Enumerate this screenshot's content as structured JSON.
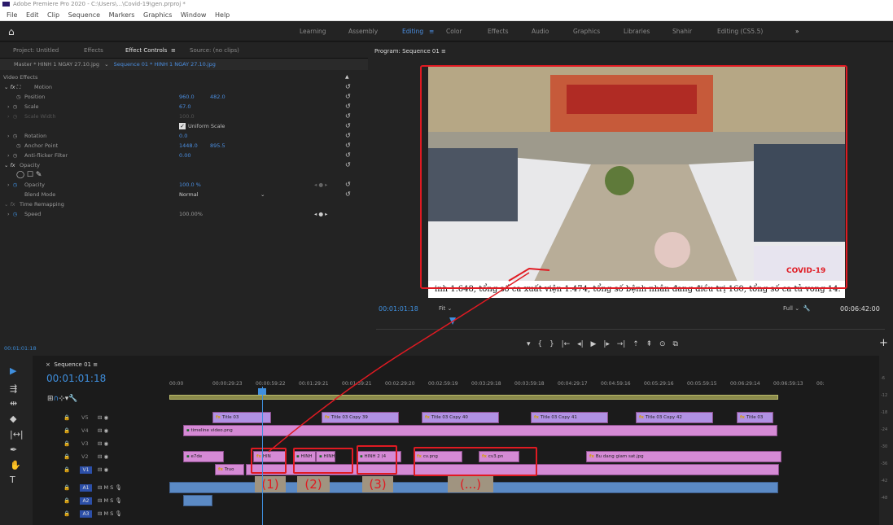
{
  "app": {
    "title": "Adobe Premiere Pro 2020 - C:\\Users\\...\\Covid-19\\gen.prproj *"
  },
  "menu": [
    "File",
    "Edit",
    "Clip",
    "Sequence",
    "Markers",
    "Graphics",
    "Window",
    "Help"
  ],
  "workspaces": [
    "Learning",
    "Assembly",
    "Editing",
    "Color",
    "Effects",
    "Audio",
    "Graphics",
    "Libraries",
    "Shahir",
    "Editing (CS5.5)"
  ],
  "panel_tabs": {
    "project": "Project: Untitled",
    "effects": "Effects",
    "effect_controls": "Effect Controls",
    "source": "Source: (no clips)"
  },
  "effect_controls": {
    "master": "Master * HINH 1 NGAY 27.10.jpg",
    "sequence": "Sequence 01 * HINH 1 NGAY 27.10.jpg",
    "video_effects": "Video Effects",
    "motion": "Motion",
    "position": {
      "label": "Position",
      "x": "960.0",
      "y": "482.0"
    },
    "scale": {
      "label": "Scale",
      "value": "67.0"
    },
    "scale_width": {
      "label": "Scale Width",
      "value": "100.0"
    },
    "uniform_scale": "Uniform Scale",
    "rotation": {
      "label": "Rotation",
      "value": "0.0"
    },
    "anchor": {
      "label": "Anchor Point",
      "x": "1448.0",
      "y": "895.5"
    },
    "antiflicker": {
      "label": "Anti-flicker Filter",
      "value": "0.00"
    },
    "opacity_group": "Opacity",
    "opacity": {
      "label": "Opacity",
      "value": "100.0 %"
    },
    "blend": {
      "label": "Blend Mode",
      "value": "Normal"
    },
    "time_remap": "Time Remapping",
    "speed": {
      "label": "Speed",
      "value": "100.00%"
    },
    "timecode": "00:01:01:18"
  },
  "program": {
    "title": "Program: Sequence 01",
    "ticker": "inh 1.648, tổng số ca xuất viện 1.474, tổng số bệnh nhân đang điều trị 160, tổng số ca tử vong 14.",
    "logo_text": "COVID-19",
    "timecode": "00:01:01:18",
    "fit": "Fit",
    "full": "Full",
    "duration": "00:06:42:00"
  },
  "timeline": {
    "tab": "Sequence 01",
    "timecode": "00:01:01:18",
    "ruler": [
      "00:00",
      "00:00:29:23",
      "00:00:59:22",
      "00:01:29:21",
      "00:01:59:21",
      "00:02:29:20",
      "00:02:59:19",
      "00:03:29:18",
      "00:03:59:18",
      "00:04:29:17",
      "00:04:59:16",
      "00:05:29:16",
      "00:05:59:15",
      "00:06:29:14",
      "00:06:59:13",
      "00:"
    ],
    "tracks": [
      "V5",
      "V4",
      "V3",
      "V2",
      "V1",
      "A1",
      "A2",
      "A3"
    ],
    "titles": [
      "Title 03",
      "Title 03 Copy 39",
      "Title 03 Copy 40",
      "Title 03 Copy 41",
      "Title 03 Copy 42",
      "Title 03"
    ],
    "v4_clip": "timeline video.png",
    "v2_clips": [
      "e7de",
      "HIN",
      "HINH",
      "HINH",
      "HINH 2 (4",
      "cv.png",
      "cv3.pn",
      "Bu dang giam sat.jpg"
    ],
    "v1_clip": "Truo",
    "annotations": [
      "(1)",
      "(2)",
      "(3)",
      "(...)"
    ]
  },
  "db_scale": [
    "-6",
    "-12",
    "-18",
    "-24",
    "-30",
    "-36",
    "-42",
    "-48"
  ],
  "colors": {
    "accent": "#3f8fde",
    "clip": "#d58ad5",
    "title_clip": "#b191e4",
    "annotation": "#e01a22"
  }
}
